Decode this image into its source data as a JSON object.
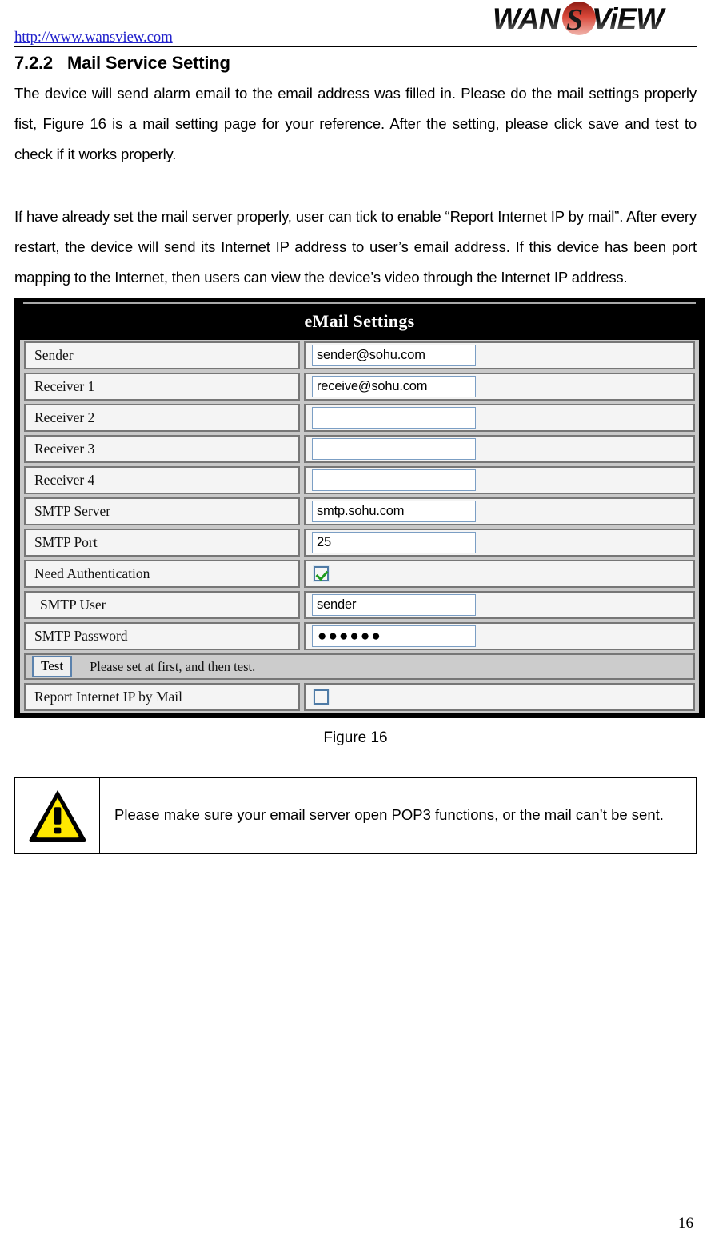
{
  "header": {
    "site_url": "http://www.wansview.com",
    "logo_text": "WANSViEW",
    "logo_colors": {
      "dark": "#1a1a1a",
      "accent": "#c0392b"
    }
  },
  "section": {
    "number": "7.2.2",
    "title": "Mail Service Setting"
  },
  "paragraphs": {
    "p1": "The device will send alarm email to the email address was filled in. Please do the mail settings properly fist, Figure 16 is a mail setting page for your reference. After the setting, please click save and test to check if it works properly.",
    "p2": "If have already set the mail server properly, user can tick to enable “Report Internet IP by mail”. After every restart, the device will send its Internet IP address to user’s email address. If this device has been port mapping to the Internet, then users can view the device’s video through the Internet IP address."
  },
  "mail_panel": {
    "title": "eMail Settings",
    "rows": [
      {
        "label": "Sender",
        "type": "text",
        "value": "sender@sohu.com",
        "indent": false
      },
      {
        "label": "Receiver 1",
        "type": "text",
        "value": "receive@sohu.com",
        "indent": false
      },
      {
        "label": "Receiver 2",
        "type": "text",
        "value": "",
        "indent": false
      },
      {
        "label": "Receiver 3",
        "type": "text",
        "value": "",
        "indent": false
      },
      {
        "label": "Receiver 4",
        "type": "text",
        "value": "",
        "indent": false
      },
      {
        "label": "SMTP Server",
        "type": "text",
        "value": "smtp.sohu.com",
        "indent": false
      },
      {
        "label": "SMTP Port",
        "type": "text",
        "value": "25",
        "indent": false
      },
      {
        "label": "Need Authentication",
        "type": "checkbox",
        "value": "checked",
        "indent": false
      },
      {
        "label": "SMTP User",
        "type": "text",
        "value": "sender",
        "indent": true
      },
      {
        "label": "SMTP Password",
        "type": "password",
        "value": "●●●●●●",
        "indent": false
      }
    ],
    "test_row": {
      "button_label": "Test",
      "note": "Please set at first, and then test."
    },
    "report_row": {
      "label": "Report Internet IP by Mail",
      "type": "checkbox",
      "value": "unchecked"
    }
  },
  "figure": {
    "caption": "Figure 16"
  },
  "warning": {
    "icon": "warning-triangle-icon",
    "icon_colors": {
      "fill": "#ffe800",
      "stroke": "#000000"
    },
    "text": "Please make sure your email server open POP3 functions, or the mail can’t be sent."
  },
  "footer": {
    "page_number": "16"
  }
}
